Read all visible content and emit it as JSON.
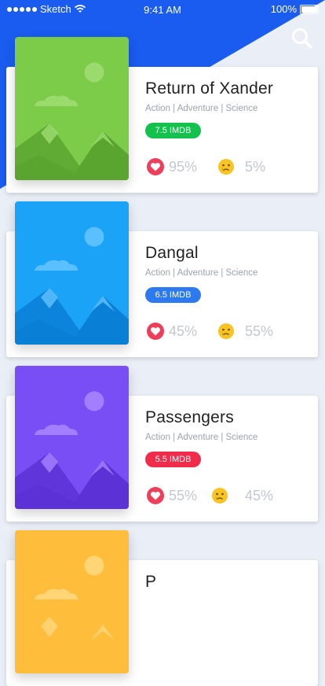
{
  "status_bar": {
    "carrier": "Sketch",
    "time": "9:41 AM",
    "battery": "100%"
  },
  "header": {
    "search_icon": "search-icon"
  },
  "colors": {
    "header_blue": "#1a5cf0",
    "like": "#ee3e5a",
    "sad": "#f7c325"
  },
  "movies": [
    {
      "title": "Return of Xander",
      "genres": "Action | Adventure | Science",
      "rating": "7.5 IMDB",
      "badge_color": "#12c24d",
      "like": "95%",
      "dislike": "5%",
      "poster_bg": "#7ccc4a",
      "poster_dark": "#5aa52f",
      "poster_light": "#9fdd72"
    },
    {
      "title": "Dangal",
      "genres": "Action | Adventure | Science",
      "rating": "6.5 IMDB",
      "badge_color": "#2d7af0",
      "like": "45%",
      "dislike": "55%",
      "poster_bg": "#1aa3f7",
      "poster_dark": "#0a7fd6",
      "poster_light": "#62c3ff"
    },
    {
      "title": "Passengers",
      "genres": "Action | Adventure | Science",
      "rating": "5.5 IMDB",
      "badge_color": "#f12c4a",
      "like": "55%",
      "dislike": "45%",
      "poster_bg": "#7a4ef5",
      "poster_dark": "#5c32d6",
      "poster_light": "#a585ff"
    },
    {
      "title": "P",
      "poster_bg": "#ffbd3c",
      "poster_light": "#ffd77c"
    }
  ]
}
